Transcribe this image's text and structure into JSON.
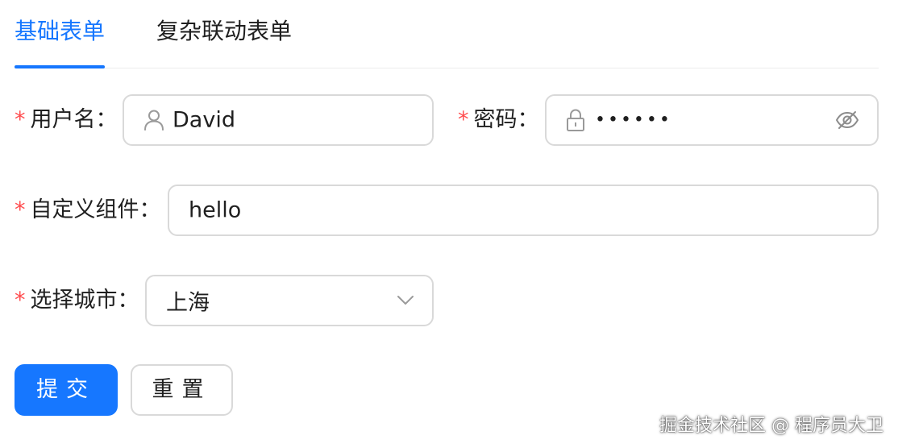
{
  "tabs": [
    {
      "label": "基础表单",
      "active": true
    },
    {
      "label": "复杂联动表单",
      "active": false
    }
  ],
  "form": {
    "required_mark": "*",
    "username": {
      "label": "用户名",
      "value": "David",
      "icon": "user-icon"
    },
    "password": {
      "label": "密码",
      "value": "••••••",
      "prefix_icon": "lock-icon",
      "suffix_icon": "eye-invisible-icon"
    },
    "custom": {
      "label": "自定义组件",
      "value": "hello"
    },
    "city": {
      "label": "选择城市",
      "value": "上海",
      "icon": "chevron-down-icon"
    },
    "colon": "："
  },
  "buttons": {
    "submit": "提交",
    "reset": "重置"
  },
  "watermark": "掘金技术社区 @ 程序员大卫",
  "colors": {
    "accent": "#1677ff",
    "required": "#ff4d4f",
    "border": "#d9d9d9"
  }
}
